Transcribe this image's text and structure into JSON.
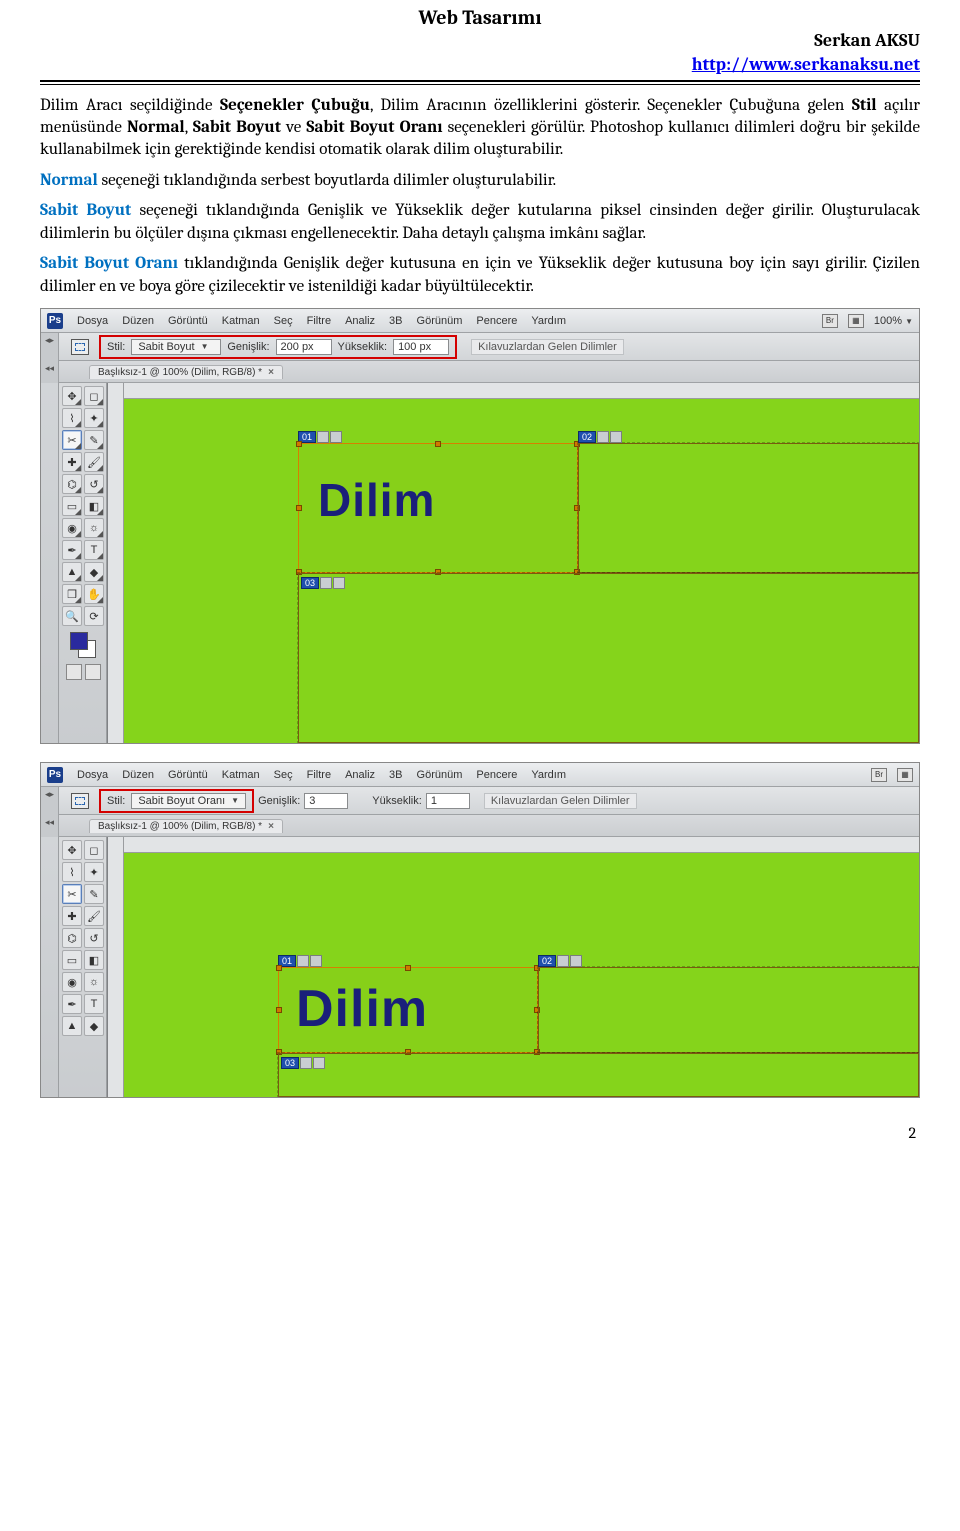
{
  "header": {
    "title": "Web Tasarımı",
    "author": "Serkan AKSU",
    "url_text": "http://www.serkanaksu.net"
  },
  "paragraphs": {
    "p1_a": "Dilim Aracı seçildiğinde ",
    "p1_b": "Seçenekler Çubuğu",
    "p1_c": ", Dilim Aracının özelliklerini gösterir. Seçenekler Çubuğuna gelen ",
    "p1_d": "Stil",
    "p1_e": " açılır menüsünde ",
    "p1_f": "Normal",
    "p1_g": ", ",
    "p1_h": "Sabit Boyut",
    "p1_i": " ve ",
    "p1_j": "Sabit Boyut Oranı",
    "p1_k": " seçenekleri görülür. Photoshop kullanıcı dilimleri doğru bir şekilde kullanabilmek için gerektiğinde kendisi otomatik olarak dilim oluşturabilir.",
    "p2_a": "Normal",
    "p2_b": " seçeneği tıklandığında serbest boyutlarda dilimler oluşturulabilir.",
    "p3_a": "Sabit Boyut",
    "p3_b": " seçeneği tıklandığında Genişlik ve Yükseklik değer kutularına piksel cinsinden değer girilir. Oluşturulacak dilimlerin bu ölçüler dışına çıkması engellenecektir. Daha detaylı çalışma imkânı sağlar.",
    "p4_a": "Sabit Boyut Oranı",
    "p4_b": " tıklandığında Genişlik değer kutusuna en için ve Yükseklik değer kutusuna boy için sayı girilir. Çizilen dilimler en ve boya göre çizilecektir ve istenildiği kadar büyültülecektir."
  },
  "ps_common": {
    "menu": [
      "Dosya",
      "Düzen",
      "Görüntü",
      "Katman",
      "Seç",
      "Filtre",
      "Analiz",
      "3B",
      "Görünüm",
      "Pencere",
      "Yardım"
    ],
    "logo_letters": "Ps",
    "br_label": "Br",
    "zoom": "100%",
    "stil_label": "Stil:",
    "tab_label": "Başlıksız-1 @ 100% (Dilim, RGB/8) *",
    "tab_close": "×",
    "genislik_label": "Genişlik:",
    "yukseklik_label": "Yükseklik:",
    "guides_btn": "Kılavuzlardan Gelen Dilimler",
    "slice_word": "Dilim",
    "slice_tags": {
      "t01": "01",
      "t02": "02",
      "t03": "03"
    }
  },
  "ps1": {
    "stil_value": "Sabit Boyut",
    "genislik_value": "200 px",
    "yukseklik_value": "100 px"
  },
  "ps2": {
    "stil_value": "Sabit Boyut Oranı",
    "genislik_value": "3",
    "yukseklik_value": "1"
  },
  "page_number": "2"
}
